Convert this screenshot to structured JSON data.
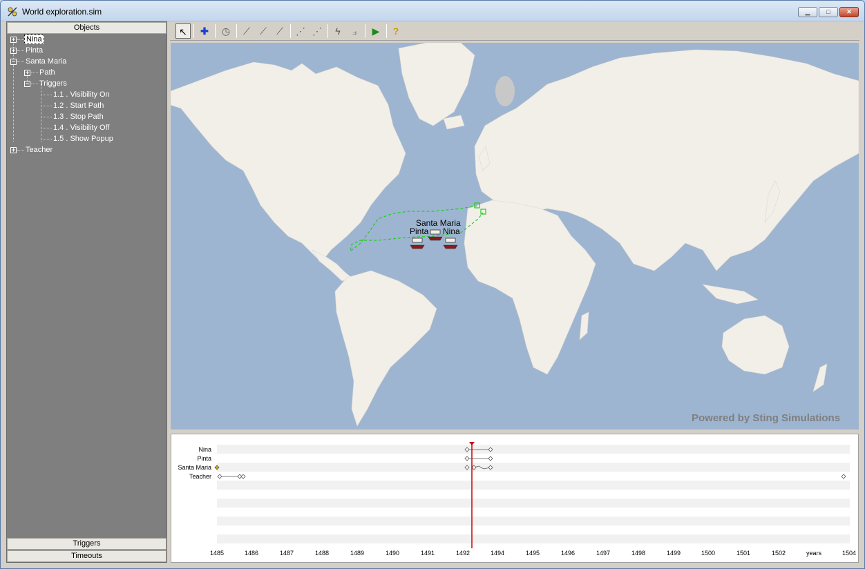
{
  "window": {
    "title": "World exploration.sim",
    "buttons": {
      "min": "▁",
      "max": "□",
      "close": "✕"
    }
  },
  "left_panel": {
    "header": "Objects",
    "tree": [
      {
        "label": "Nina",
        "expander": "+",
        "selected": true
      },
      {
        "label": "Pinta",
        "expander": "+"
      },
      {
        "label": "Santa Maria",
        "expander": "−"
      },
      {
        "label": "Path",
        "expander": "+"
      },
      {
        "label": "Triggers",
        "expander": "−"
      },
      {
        "label": "1.1 . Visibility On"
      },
      {
        "label": "1.2 . Start Path"
      },
      {
        "label": "1.3 . Stop Path"
      },
      {
        "label": "1.4 . Visibility Off"
      },
      {
        "label": "1.5 . Show Popup"
      },
      {
        "label": "Teacher",
        "expander": "+"
      }
    ],
    "footer_tabs": [
      "Triggers",
      "Timeouts"
    ]
  },
  "toolbar": {
    "tools": [
      {
        "name": "select-tool",
        "glyph": "↖"
      },
      {
        "name": "add-object-tool",
        "glyph": "✚"
      },
      {
        "name": "timer-tool",
        "glyph": "◷"
      },
      {
        "name": "add-path-tool-1",
        "glyph": "⟋"
      },
      {
        "name": "add-path-tool-2",
        "glyph": "⟋"
      },
      {
        "name": "add-path-tool-3",
        "glyph": "⟋"
      },
      {
        "name": "add-point-tool",
        "glyph": "⋰"
      },
      {
        "name": "remove-point-tool",
        "glyph": "⋰"
      },
      {
        "name": "lightning-tool",
        "glyph": "ϟ"
      },
      {
        "name": "connect-tool",
        "glyph": "⟓"
      },
      {
        "name": "play-tool",
        "glyph": "▶"
      },
      {
        "name": "help-tool",
        "glyph": "?"
      }
    ]
  },
  "map": {
    "ships": [
      "Santa Maria",
      "Pinta",
      "Nina"
    ],
    "watermark": "Powered by Sting Simulations",
    "colors": {
      "ocean": "#9db5d1",
      "land": "#f2efe9",
      "path": "#22cc22",
      "ship": "#8b1a1a"
    }
  },
  "timeline": {
    "rows": [
      "Nina",
      "Pinta",
      "Santa Maria",
      "Teacher"
    ],
    "years": [
      "1485",
      "1486",
      "1487",
      "1488",
      "1489",
      "1490",
      "1491",
      "1492",
      "1494",
      "1495",
      "1496",
      "1497",
      "1498",
      "1499",
      "1500",
      "1501",
      "1502",
      "years",
      "1504"
    ],
    "current_marker_color": "#cc0000"
  }
}
